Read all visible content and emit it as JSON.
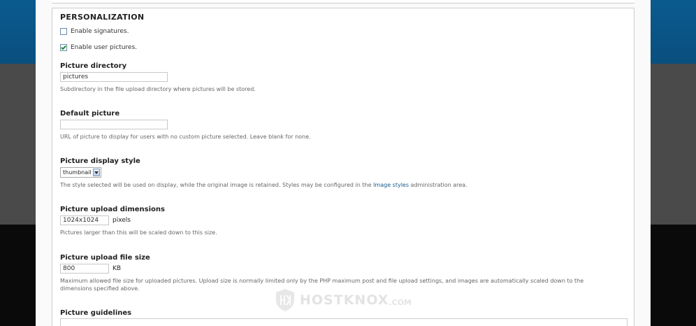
{
  "section": {
    "title": "PERSONALIZATION"
  },
  "checkboxes": [
    {
      "label": "Enable signatures.",
      "checked": false
    },
    {
      "label": "Enable user pictures.",
      "checked": true
    }
  ],
  "picture_directory": {
    "label": "Picture directory",
    "value": "pictures",
    "description": "Subdirectory in the file upload directory where pictures will be stored."
  },
  "default_picture": {
    "label": "Default picture",
    "value": "",
    "description": "URL of picture to display for users with no custom picture selected. Leave blank for none."
  },
  "display_style": {
    "label": "Picture display style",
    "selected": "thumbnail",
    "description_before": "The style selected will be used on display, while the original image is retained. Styles may be configured in the ",
    "link_text": "Image styles",
    "description_after": " administration area."
  },
  "upload_dimensions": {
    "label": "Picture upload dimensions",
    "value": "1024x1024",
    "suffix": "pixels",
    "description": "Pictures larger than this will be scaled down to this size."
  },
  "upload_file_size": {
    "label": "Picture upload file size",
    "value": "800",
    "suffix": "KB",
    "description": "Maximum allowed file size for uploaded pictures. Upload size is normally limited only by the PHP maximum post and file upload settings, and images are automatically scaled down to the dimensions specified above."
  },
  "guidelines": {
    "label": "Picture guidelines"
  },
  "watermark": {
    "text": "HOSTKNOX",
    "domain": ".COM"
  },
  "colors": {
    "header_blue": "#0b5a8f",
    "link": "#1a5e8a",
    "check_green": "#2a8a2a"
  }
}
